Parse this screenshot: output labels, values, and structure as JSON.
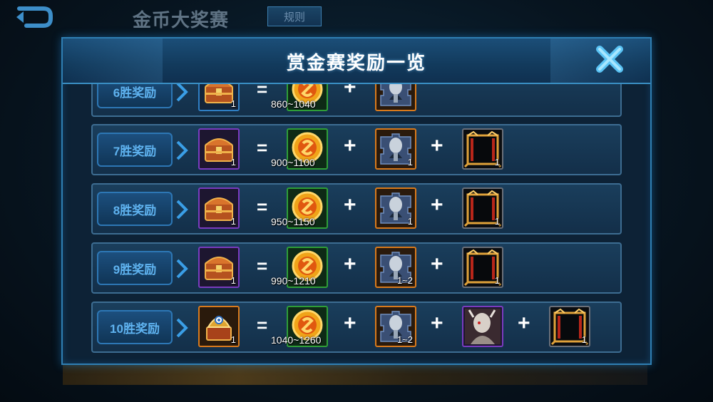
{
  "page": {
    "title": "金币大奖赛",
    "rules_label": "规则"
  },
  "icons": {
    "back": "back-arrow-icon",
    "close": "close-x-icon",
    "row_arrow": "chevron-right-icon"
  },
  "colors": {
    "accent_blue": "#2f7fb3",
    "label_text": "#5fb3f0",
    "purple_frame": "#7a3bbf",
    "green_frame": "#2f9e38",
    "orange_frame": "#d97a1c"
  },
  "modal": {
    "title": "赏金赛奖励一览",
    "rows": [
      {
        "label": "6胜奖励",
        "chest": {
          "icon": "treasure-chest-icon",
          "count": "1",
          "frame": "blue"
        },
        "gold_range": "860~1040",
        "items": [
          {
            "icon": "hero-fragment-icon",
            "count": "",
            "frame": "orange"
          }
        ]
      },
      {
        "label": "7胜奖励",
        "chest": {
          "icon": "treasure-chest-icon",
          "count": "1",
          "frame": "purple"
        },
        "gold_range": "900~1100",
        "items": [
          {
            "icon": "hero-fragment-icon",
            "count": "1",
            "frame": "orange"
          },
          {
            "icon": "avatar-frame-icon",
            "count": "1",
            "frame": "gray"
          }
        ]
      },
      {
        "label": "8胜奖励",
        "chest": {
          "icon": "treasure-chest-icon",
          "count": "1",
          "frame": "purple"
        },
        "gold_range": "950~1150",
        "items": [
          {
            "icon": "hero-fragment-icon",
            "count": "1",
            "frame": "orange"
          },
          {
            "icon": "avatar-frame-icon",
            "count": "1",
            "frame": "gray"
          }
        ]
      },
      {
        "label": "9胜奖励",
        "chest": {
          "icon": "treasure-chest-icon",
          "count": "1",
          "frame": "purple"
        },
        "gold_range": "990~1210",
        "items": [
          {
            "icon": "hero-fragment-icon",
            "count": "1~2",
            "frame": "orange"
          },
          {
            "icon": "avatar-frame-icon",
            "count": "1",
            "frame": "gray"
          }
        ]
      },
      {
        "label": "10胜奖励",
        "chest": {
          "icon": "golden-helmet-chest-icon",
          "count": "1",
          "frame": "orange"
        },
        "gold_range": "1040~1260",
        "items": [
          {
            "icon": "hero-fragment-icon",
            "count": "1~2",
            "frame": "orange"
          },
          {
            "icon": "hero-skin-portrait-icon",
            "count": "",
            "frame": "purple"
          },
          {
            "icon": "avatar-frame-icon",
            "count": "1",
            "frame": "gray"
          }
        ]
      }
    ]
  }
}
